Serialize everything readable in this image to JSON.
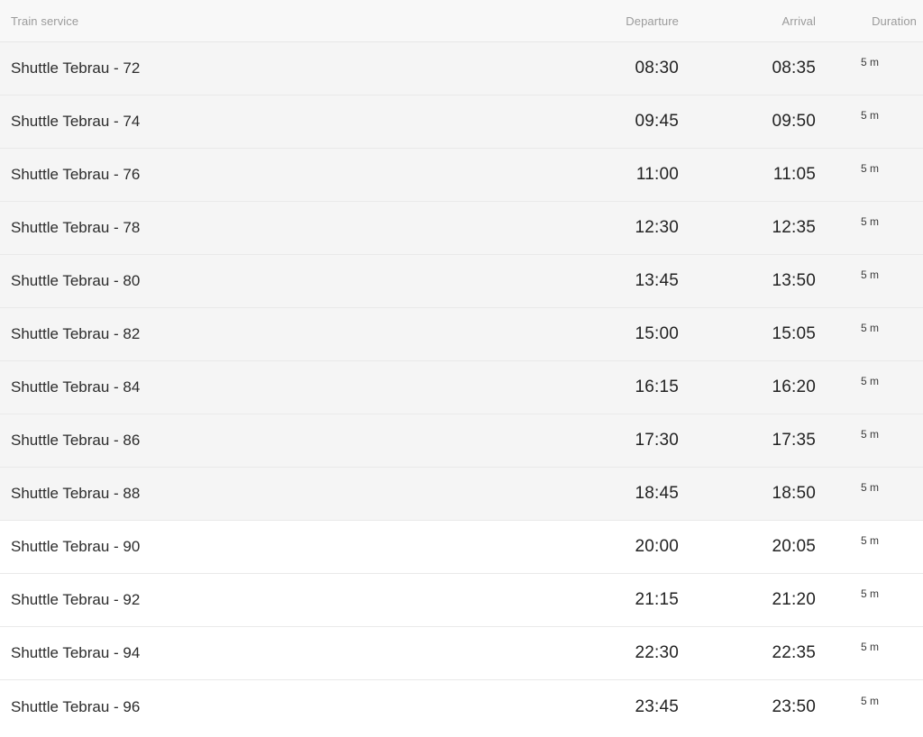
{
  "table": {
    "columns": [
      {
        "key": "service",
        "label": "Train service"
      },
      {
        "key": "departure",
        "label": "Departure"
      },
      {
        "key": "arrival",
        "label": "Arrival"
      },
      {
        "key": "duration",
        "label": "Duration"
      }
    ],
    "rows": [
      {
        "service": "Shuttle Tebrau - 72",
        "departure": "08:30",
        "arrival": "08:35",
        "duration": "5 m"
      },
      {
        "service": "Shuttle Tebrau - 74",
        "departure": "09:45",
        "arrival": "09:50",
        "duration": "5 m"
      },
      {
        "service": "Shuttle Tebrau - 76",
        "departure": "11:00",
        "arrival": "11:05",
        "duration": "5 m"
      },
      {
        "service": "Shuttle Tebrau - 78",
        "departure": "12:30",
        "arrival": "12:35",
        "duration": "5 m"
      },
      {
        "service": "Shuttle Tebrau - 80",
        "departure": "13:45",
        "arrival": "13:50",
        "duration": "5 m"
      },
      {
        "service": "Shuttle Tebrau - 82",
        "departure": "15:00",
        "arrival": "15:05",
        "duration": "5 m"
      },
      {
        "service": "Shuttle Tebrau - 84",
        "departure": "16:15",
        "arrival": "16:20",
        "duration": "5 m"
      },
      {
        "service": "Shuttle Tebrau - 86",
        "departure": "17:30",
        "arrival": "17:35",
        "duration": "5 m"
      },
      {
        "service": "Shuttle Tebrau - 88",
        "departure": "18:45",
        "arrival": "18:50",
        "duration": "5 m"
      },
      {
        "service": "Shuttle Tebrau - 90",
        "departure": "20:00",
        "arrival": "20:05",
        "duration": "5 m"
      },
      {
        "service": "Shuttle Tebrau - 92",
        "departure": "21:15",
        "arrival": "21:20",
        "duration": "5 m"
      },
      {
        "service": "Shuttle Tebrau - 94",
        "departure": "22:30",
        "arrival": "22:35",
        "duration": "5 m"
      },
      {
        "service": "Shuttle Tebrau - 96",
        "departure": "23:45",
        "arrival": "23:50",
        "duration": "5 m"
      }
    ],
    "shaded_row_count": 9,
    "colors": {
      "header_background": "#f8f8f8",
      "header_text": "#9b9b9b",
      "shaded_row_background": "#f5f5f5",
      "plain_row_background": "#ffffff",
      "row_divider": "#e9e9e9",
      "primary_text": "#2c2c2c",
      "time_text": "#222222",
      "duration_text": "#3a3a3a"
    }
  }
}
